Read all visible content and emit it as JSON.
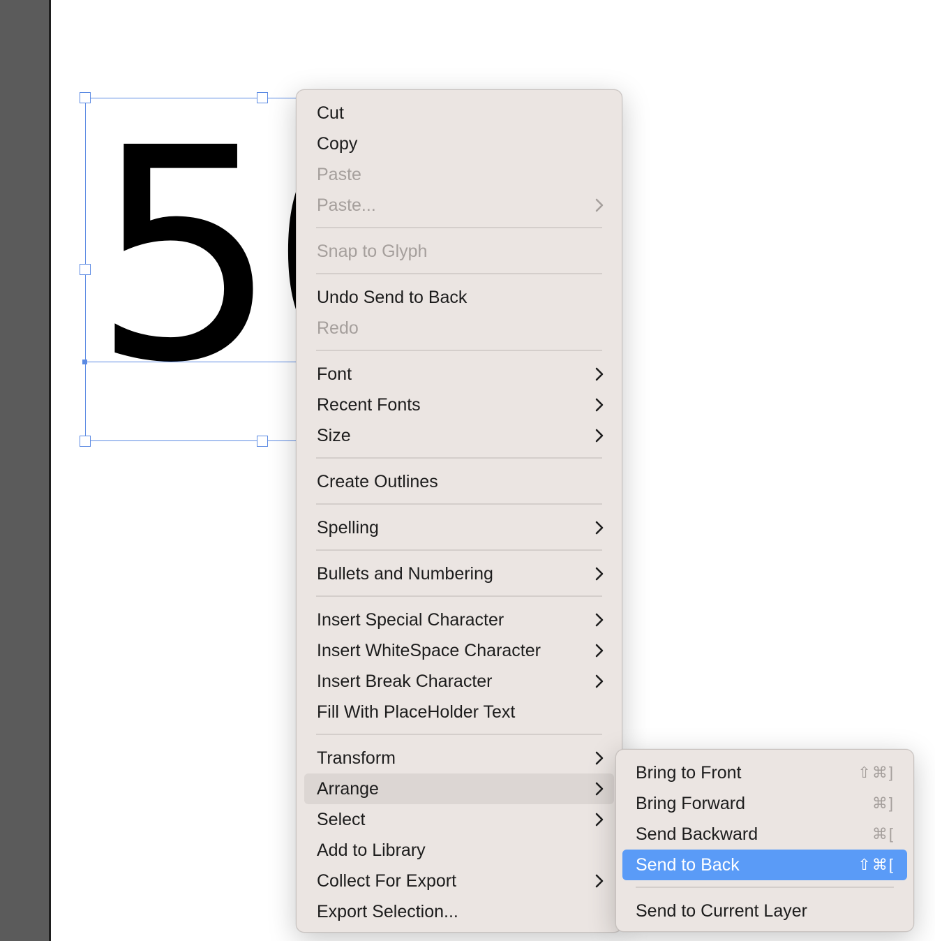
{
  "canvas": {
    "big_text": "50"
  },
  "context_menu": {
    "items": [
      {
        "label": "Cut",
        "enabled": true,
        "submenu": false
      },
      {
        "label": "Copy",
        "enabled": true,
        "submenu": false
      },
      {
        "label": "Paste",
        "enabled": false,
        "submenu": false
      },
      {
        "label": "Paste...",
        "enabled": false,
        "submenu": true
      },
      {
        "label": "Snap to Glyph",
        "enabled": false,
        "submenu": false
      },
      {
        "label": "Undo Send to Back",
        "enabled": true,
        "submenu": false
      },
      {
        "label": "Redo",
        "enabled": false,
        "submenu": false
      },
      {
        "label": "Font",
        "enabled": true,
        "submenu": true
      },
      {
        "label": "Recent Fonts",
        "enabled": true,
        "submenu": true
      },
      {
        "label": "Size",
        "enabled": true,
        "submenu": true
      },
      {
        "label": "Create Outlines",
        "enabled": true,
        "submenu": false
      },
      {
        "label": "Spelling",
        "enabled": true,
        "submenu": true
      },
      {
        "label": "Bullets and Numbering",
        "enabled": true,
        "submenu": true
      },
      {
        "label": "Insert Special Character",
        "enabled": true,
        "submenu": true
      },
      {
        "label": "Insert WhiteSpace Character",
        "enabled": true,
        "submenu": true
      },
      {
        "label": "Insert Break Character",
        "enabled": true,
        "submenu": true
      },
      {
        "label": "Fill With PlaceHolder Text",
        "enabled": true,
        "submenu": false
      },
      {
        "label": "Transform",
        "enabled": true,
        "submenu": true
      },
      {
        "label": "Arrange",
        "enabled": true,
        "submenu": true,
        "highlighted": true
      },
      {
        "label": "Select",
        "enabled": true,
        "submenu": true
      },
      {
        "label": "Add to Library",
        "enabled": true,
        "submenu": false
      },
      {
        "label": "Collect For Export",
        "enabled": true,
        "submenu": true
      },
      {
        "label": "Export Selection...",
        "enabled": true,
        "submenu": false
      }
    ]
  },
  "arrange_submenu": {
    "items": [
      {
        "label": "Bring to Front",
        "shortcut": "⇧⌘]"
      },
      {
        "label": "Bring Forward",
        "shortcut": "⌘]"
      },
      {
        "label": "Send Backward",
        "shortcut": "⌘["
      },
      {
        "label": "Send to Back",
        "shortcut": "⇧⌘[",
        "selected": true
      },
      {
        "label": "Send to Current Layer",
        "shortcut": ""
      }
    ]
  },
  "colors": {
    "selection": "#5a9bf7",
    "frame": "#5b8ae3",
    "menu_bg": "#ebe5e2"
  }
}
